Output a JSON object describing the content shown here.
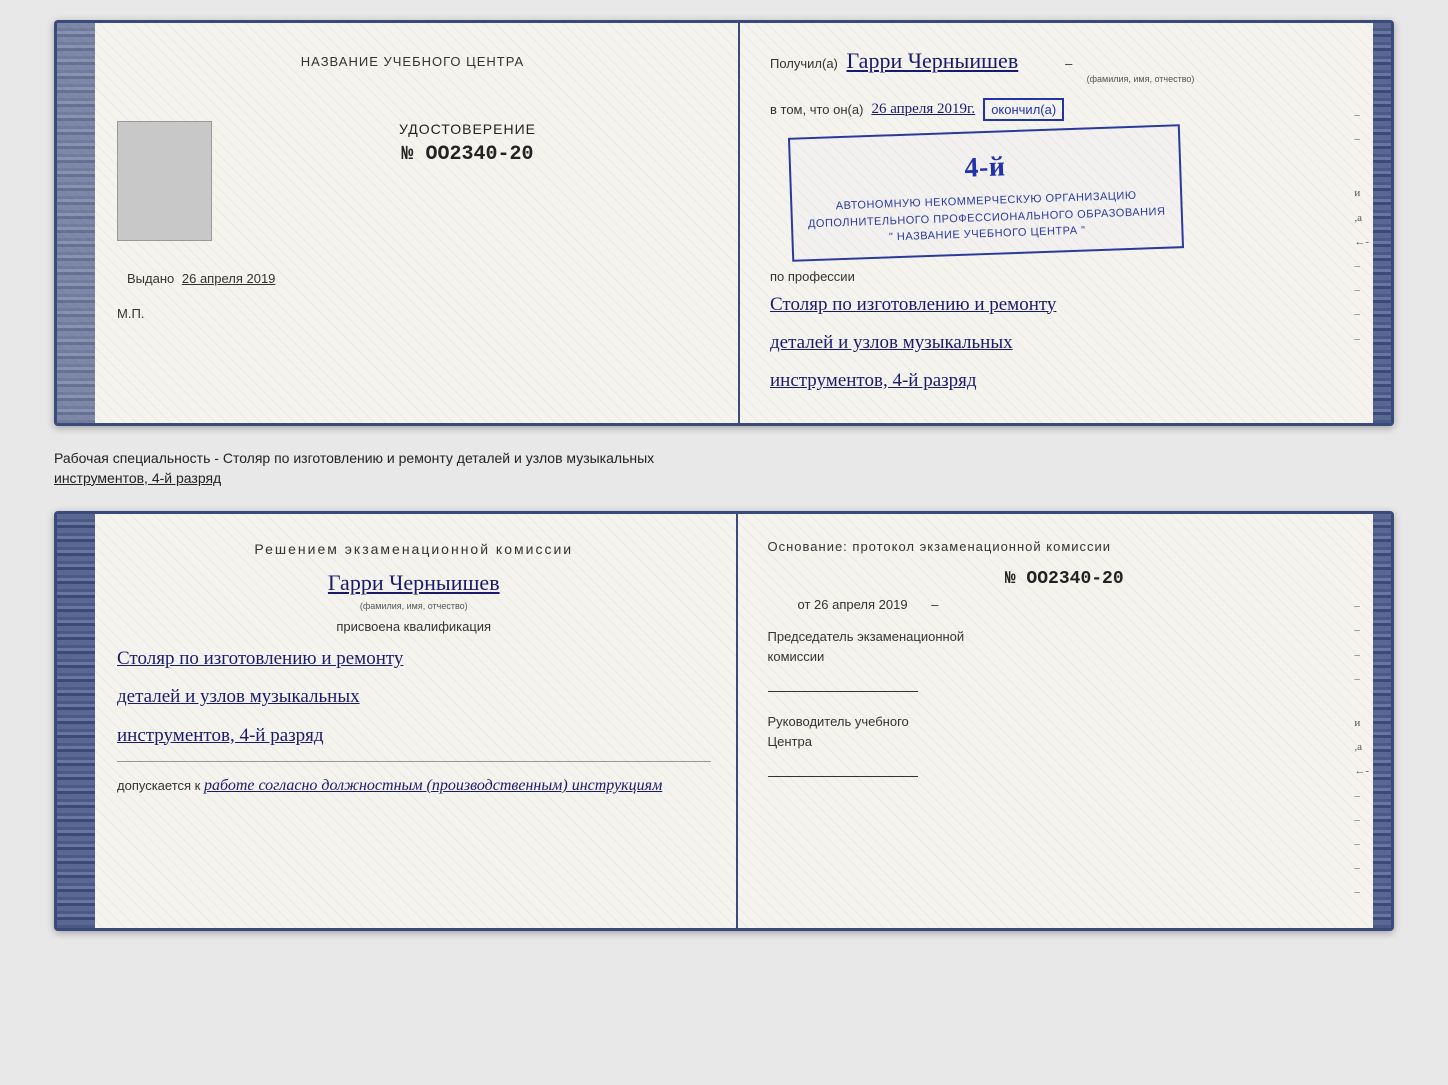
{
  "top_doc": {
    "left": {
      "center_title": "НАЗВАНИЕ УЧЕБНОГО ЦЕНТРА",
      "cert_section": {
        "cert_label": "УДОСТОВЕРЕНИЕ",
        "cert_number": "№ OO2340-20",
        "vydano_label": "Выдано",
        "vydano_date": "26 апреля 2019",
        "mp_label": "М.П."
      }
    },
    "right": {
      "received_prefix": "Получил(а)",
      "name_handwritten": "Гарри Черныишев",
      "name_sub": "(фамилия, имя, отчество)",
      "vtom_prefix": "в том, что он(а)",
      "vtom_date": "26 апреля 2019г.",
      "vtom_dash": "–",
      "okonchil": "окончил(а)",
      "stamp_line1": "АВТОНОМНУЮ НЕКОММЕРЧЕСКУЮ ОРГАНИЗАЦИЮ",
      "stamp_line2": "ДОПОЛНИТЕЛЬНОГО ПРОФЕССИОНАЛЬНОГО ОБРАЗОВАНИЯ",
      "stamp_line3": "\" НАЗВАНИЕ УЧЕБНОГО ЦЕНТРА \"",
      "stamp_big_text": "4-й",
      "po_professii": "по профессии",
      "profession_line1": "Столяр по изготовлению и ремонту",
      "profession_line2": "деталей и узлов музыкальных",
      "profession_line3": "инструментов, 4-й разряд"
    }
  },
  "separator": {
    "text_normal": "Рабочая специальность - Столяр по изготовлению и ремонту деталей и узлов музыкальных",
    "text_underline": "инструментов, 4-й разряд"
  },
  "bottom_doc": {
    "left": {
      "resheniyem_title": "Решением  экзаменационной  комиссии",
      "name_handwritten": "Гарри Черныишев",
      "name_sub": "(фамилия, имя, отчество)",
      "prisvoena": "присвоена квалификация",
      "qual_line1": "Столяр по изготовлению и ремонту",
      "qual_line2": "деталей и узлов музыкальных",
      "qual_line3": "инструментов, 4-й разряд",
      "dopuskaetsya_prefix": "допускается к",
      "dopuskaetsya_italic": "работе согласно должностным (производственным) инструкциям"
    },
    "right": {
      "osnovanie_text": "Основание:  протокол  экзаменационной  комиссии",
      "protocol_number": "№  OO2340-20",
      "ot_prefix": "от",
      "ot_date": "26 апреля 2019",
      "predsedatel_line1": "Председатель экзаменационной",
      "predsedatel_line2": "комиссии",
      "rukovoditel_line1": "Руководитель учебного",
      "rukovoditel_line2": "Центра"
    }
  }
}
